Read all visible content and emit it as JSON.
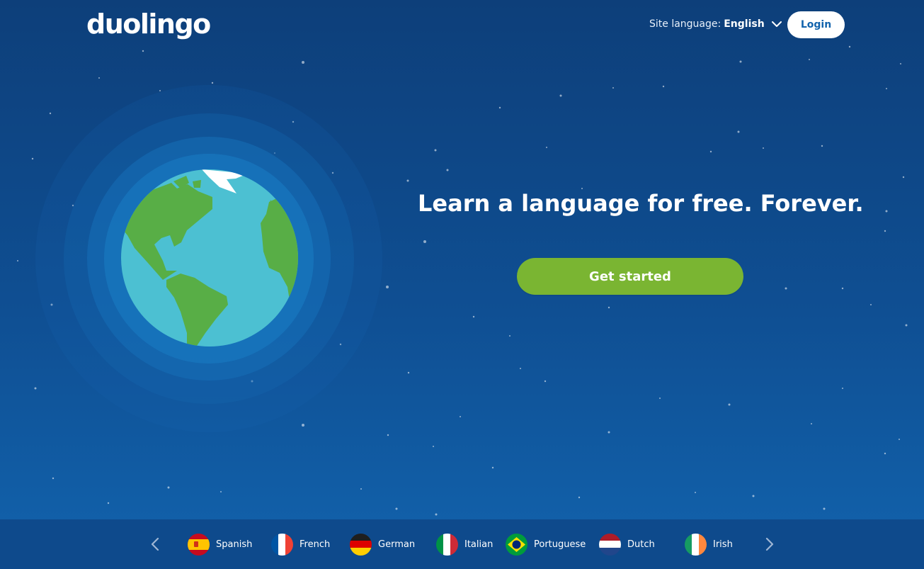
{
  "header": {
    "logo_text": "duolingo",
    "site_language_label": "Site language:",
    "site_language_value": "English",
    "login_label": "Login"
  },
  "hero": {
    "headline": "Learn a language for free. Forever.",
    "cta_label": "Get started"
  },
  "colors": {
    "background_top": "#0d3f7a",
    "background_bottom": "#1263ad",
    "cta_green": "#7ab532",
    "ocean": "#4cc0d2",
    "land": "#58ae46"
  },
  "languages": [
    {
      "name": "Spanish",
      "flag": "spain-flag-icon"
    },
    {
      "name": "French",
      "flag": "france-flag-icon"
    },
    {
      "name": "German",
      "flag": "germany-flag-icon"
    },
    {
      "name": "Italian",
      "flag": "italy-flag-icon"
    },
    {
      "name": "Portuguese",
      "flag": "brazil-flag-icon"
    },
    {
      "name": "Dutch",
      "flag": "netherlands-flag-icon"
    },
    {
      "name": "Irish",
      "flag": "ireland-flag-icon"
    }
  ]
}
